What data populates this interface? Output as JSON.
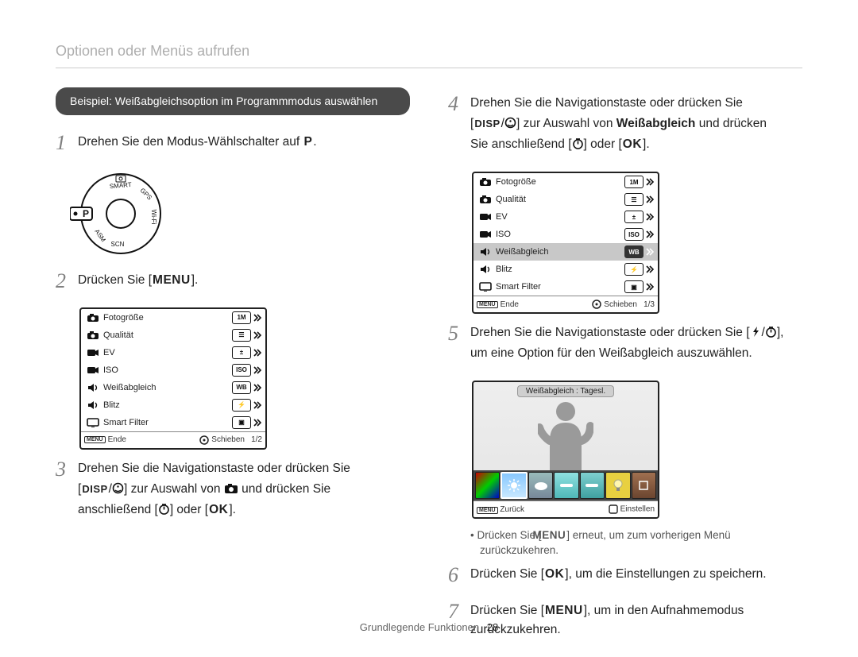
{
  "header": "Optionen oder Menüs aufrufen",
  "pill": "Beispiel: Weißabgleichsoption im Programmmodus auswählen",
  "steps": {
    "s1": {
      "num": "1",
      "pre": "Drehen Sie den Modus-Wählschalter auf ",
      "mode_letter": "P",
      "post": "."
    },
    "s2": {
      "num": "2",
      "pre": "Drücken Sie [",
      "btn": "MENU",
      "post": "]."
    },
    "s3": {
      "num": "3",
      "line1_a": "Drehen Sie die Navigationstaste oder drücken Sie",
      "disp": "DISP",
      "line2_b": " zur Auswahl von ",
      "line2_c": " und drücken Sie",
      "line3_a": "anschließend [",
      "line3_b": "] oder [",
      "ok": "OK",
      "line3_c": "]."
    },
    "s4": {
      "num": "4",
      "line1": "Drehen Sie die Navigationstaste oder drücken Sie",
      "disp": "DISP",
      "line2_a": " zur Auswahl von ",
      "bold_wb": "Weißabgleich",
      "line2_b": " und drücken",
      "line3_a": "Sie anschließend [",
      "line3_b": "] oder [",
      "ok": "OK",
      "line3_c": "]."
    },
    "s5": {
      "num": "5",
      "line1_a": "Drehen Sie die Navigationstaste oder drücken Sie [",
      "line1_b": "],",
      "line2": "um eine Option für den Weißabgleich auszuwählen."
    },
    "s5_note": {
      "bullet": "•",
      "a": "Drücken Sie [",
      "btn": "MENU",
      "b": "] erneut, um zum vorherigen Menü zurückzukehren."
    },
    "s6": {
      "num": "6",
      "a": "Drücken Sie [",
      "ok": "OK",
      "b": "], um die Einstellungen zu speichern."
    },
    "s7": {
      "num": "7",
      "a": "Drücken Sie [",
      "btn": "MENU",
      "b": "], um in den Aufnahmemodus zurückzukehren."
    }
  },
  "menu_panel": {
    "rows": [
      {
        "icon": "camera",
        "label": "Fotogröße",
        "badge": "1M"
      },
      {
        "icon": "camera",
        "label": "Qualität",
        "badge": "☰"
      },
      {
        "icon": "video",
        "label": "EV",
        "badge": "±"
      },
      {
        "icon": "video",
        "label": "ISO",
        "badge": "ISO"
      },
      {
        "icon": "sound",
        "label": "Weißabgleich",
        "badge": "WB"
      },
      {
        "icon": "sound",
        "label": "Blitz",
        "badge": "⚡"
      },
      {
        "icon": "display",
        "label": "Smart Filter",
        "badge": "▣"
      }
    ],
    "footer_left_badge": "MENU",
    "footer_left": "Ende",
    "footer_right": "Schieben",
    "page_a": "1/2",
    "page_b": "1/3"
  },
  "wb_panel": {
    "title": "Weißabgleich : Tagesl.",
    "footer_left_badge": "MENU",
    "footer_left": "Zurück",
    "footer_right": "Einstellen"
  },
  "mode_dial": {
    "labels": [
      "SMART",
      "GPS",
      "Wi-Fi",
      "SCN",
      "ASM",
      "P"
    ]
  },
  "footer": {
    "section": "Grundlegende Funktionen",
    "page": "28"
  }
}
